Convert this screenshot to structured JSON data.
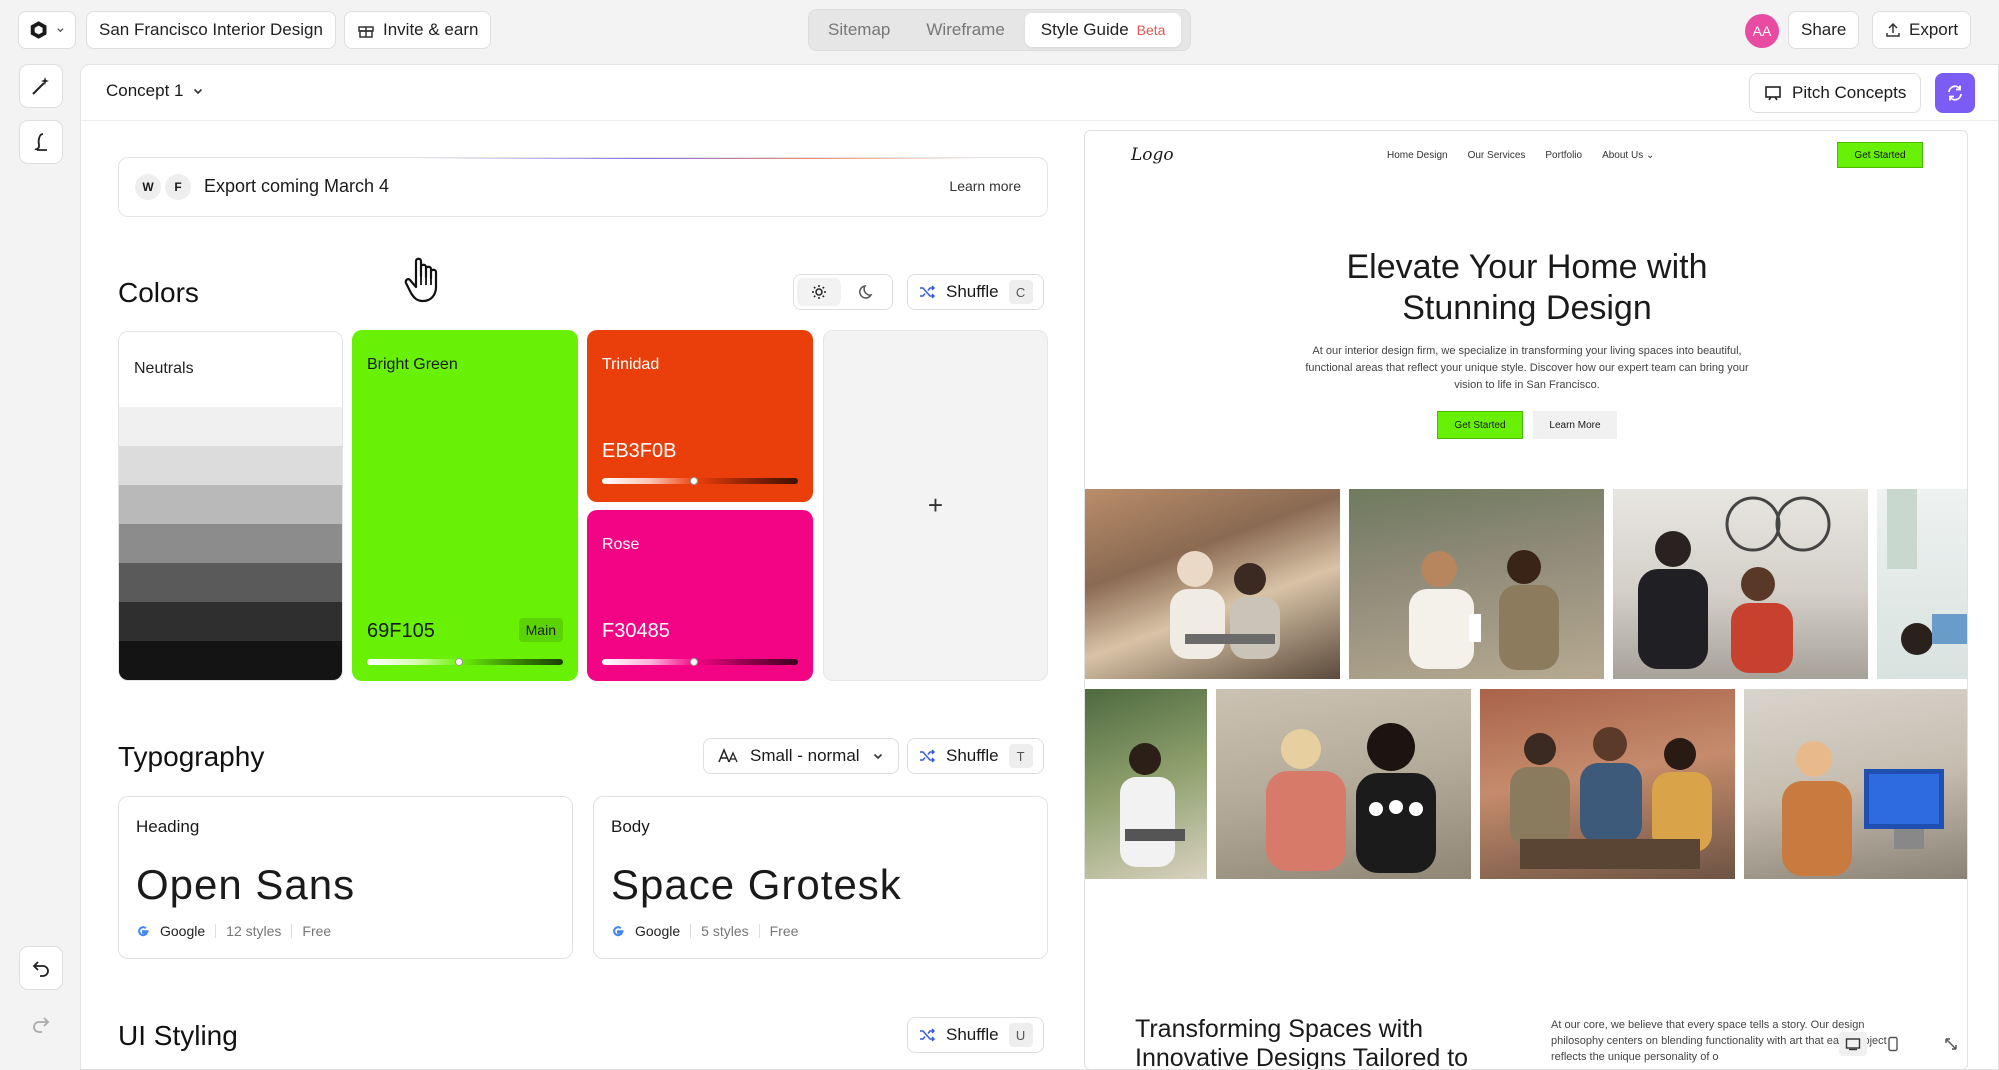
{
  "topbar": {
    "project_name": "San Francisco Interior Design",
    "invite_label": "Invite & earn",
    "tabs": [
      {
        "label": "Sitemap"
      },
      {
        "label": "Wireframe"
      },
      {
        "label": "Style Guide",
        "badge": "Beta"
      }
    ],
    "avatar_initials": "AA",
    "share_label": "Share",
    "export_label": "Export"
  },
  "panel": {
    "concept_label": "Concept 1",
    "pitch_label": "Pitch Concepts"
  },
  "banner": {
    "icon_a": "W",
    "icon_b": "F",
    "text": "Export coming March 4",
    "learn_more": "Learn more"
  },
  "colors": {
    "title": "Colors",
    "shuffle_label": "Shuffle",
    "shuffle_key": "C",
    "neutrals": {
      "label": "Neutrals",
      "shades": [
        "#f0f0f0",
        "#dcdcdc",
        "#b9b9b9",
        "#8c8c8c",
        "#5a5a5a",
        "#2f2f2f",
        "#141414"
      ]
    },
    "primary": {
      "name": "Bright Green",
      "hex": "69F105",
      "badge": "Main",
      "color": "#69F105",
      "slider_pos": 0.48
    },
    "secondary": {
      "name": "Trinidad",
      "hex": "EB3F0B",
      "color": "#EB3F0B",
      "slider_pos": 0.48
    },
    "tertiary": {
      "name": "Rose",
      "hex": "F30485",
      "color": "#F30485",
      "slider_pos": 0.48
    },
    "add_label": "+"
  },
  "typography": {
    "title": "Typography",
    "size_label": "Small - normal",
    "shuffle_label": "Shuffle",
    "shuffle_key": "T",
    "heading": {
      "label": "Heading",
      "font": "Open Sans",
      "source": "Google",
      "styles": "12 styles",
      "price": "Free"
    },
    "body": {
      "label": "Body",
      "font": "Space Grotesk",
      "source": "Google",
      "styles": "5 styles",
      "price": "Free"
    }
  },
  "ui_styling": {
    "title": "UI Styling",
    "shuffle_label": "Shuffle",
    "shuffle_key": "U"
  },
  "preview": {
    "logo": "Logo",
    "nav": [
      "Home Design",
      "Our Services",
      "Portfolio",
      "About Us"
    ],
    "cta": "Get Started",
    "hero_line1": "Elevate Your Home with",
    "hero_line2": "Stunning Design",
    "subtext": "At our interior design firm, we specialize in transforming your living spaces into beautiful, functional areas that reflect your unique style. Discover how our expert team can bring your vision to life in San Francisco.",
    "primary_btn": "Get Started",
    "secondary_btn": "Learn More",
    "footer_heading": "Transforming Spaces with Innovative Designs Tailored to",
    "footer_text": "At our core, we believe that every space tells a story. Our design philosophy centers on blending functionality with art that each project reflects the unique personality of o"
  }
}
